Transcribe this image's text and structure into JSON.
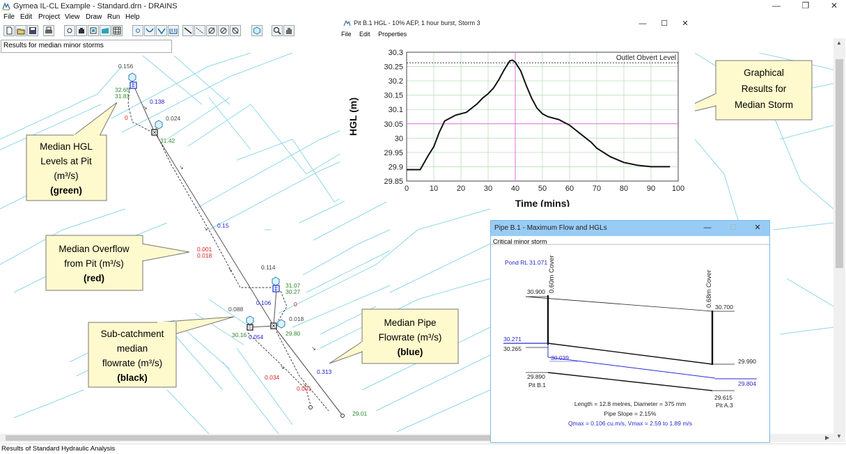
{
  "app": {
    "title": "Gymea IL-CL Example - Standard.drn - DRAINS",
    "icon": "drains-app-icon"
  },
  "window_controls": {
    "minimize": "—",
    "restore": "❐",
    "close": "✕"
  },
  "menu": [
    "File",
    "Edit",
    "Project",
    "View",
    "Draw",
    "Run",
    "Help"
  ],
  "toolbar": {
    "icons": [
      "new-file-icon",
      "open-file-icon",
      "save-icon",
      "print-icon",
      "node-icon",
      "pit-icon",
      "detention-icon",
      "storage-icon",
      "grid-icon",
      "node-circle-icon",
      "channel-icon",
      "overflow-route-icon",
      "weir-icon",
      "pipe-icon",
      "link-icon",
      "sub-catchment-icon",
      "detention-basin-icon",
      "hexagon-icon",
      "zoom-icon",
      "pan-hand-icon"
    ]
  },
  "results_label": "Results for median minor storms",
  "status_bar": "Results of Standard Hydraulic Analysis",
  "drawing": {
    "labels": {
      "pit1_flow": "0.156",
      "pit1_hgl_top": "32.65",
      "pit1_hgl_bottom": "31.81",
      "pit1_overflow": "0",
      "pipe1_flow": "0.138",
      "node2_flow": "0.024",
      "node2_hgl": "31.42",
      "pipe2_flow": "0.15",
      "overflow_a": "0.001",
      "overflow_b": "0.018",
      "pit3_flow": "0.114",
      "pit3_hgl_top": "31.07",
      "pit3_hgl_bottom": "30.27",
      "pit3_overflow": "0",
      "pipe3_flow": "0.106",
      "node4_flow": "0.018",
      "sub_flow": "0.088",
      "sub_hgl": "30.16",
      "sub_pipe_flow": "0.054",
      "node5_hgl": "29.80",
      "overflow_c": "0.034",
      "overflow_d": "0.001",
      "pipe5_flow": "0.313",
      "outlet_hgl": "29.01"
    },
    "colors": {
      "hgl": "#2e8b2e",
      "overflow": "#dd2222",
      "pipe_flow": "#2020d0",
      "catchment_flow": "#333333"
    }
  },
  "callouts": {
    "hgl": {
      "lines": [
        "Median HGL",
        "Levels at Pit",
        "(m³/s)"
      ],
      "emphasis": "(green)",
      "emphasis_color": "#2e9c2e"
    },
    "overflow": {
      "lines": [
        "Median Overflow",
        "from Pit (m³/s)"
      ],
      "emphasis": "(red)",
      "emphasis_color": "#e02020"
    },
    "subcatchment": {
      "lines": [
        "Sub-catchment",
        "median",
        "flowrate (m³/s)"
      ],
      "emphasis": "(black)",
      "emphasis_color": "#000000"
    },
    "pipe": {
      "lines": [
        "Median Pipe",
        "Flowrate (m³/s)"
      ],
      "emphasis": "(blue)",
      "emphasis_color": "#2222cc"
    },
    "graph": {
      "lines": [
        "Graphical",
        "Results for",
        "Median Storm"
      ]
    }
  },
  "hgl_window": {
    "title": "Pit B.1 HGL  -  10% AEP, 1 hour burst, Storm 3",
    "menu": [
      "File",
      "Edit",
      "Properties"
    ],
    "controls": {
      "minimize": "—",
      "maximize": "☐",
      "close": "✕"
    },
    "icon": "graph-window-icon"
  },
  "chart_data": {
    "type": "line",
    "title": "",
    "xlabel": "Time (mins)",
    "ylabel": "HGL (m)",
    "xlim": [
      0,
      100
    ],
    "ylim": [
      29.85,
      30.3
    ],
    "x_ticks": [
      "0",
      "10",
      "20",
      "30",
      "40",
      "50",
      "60",
      "70",
      "80",
      "90",
      "100"
    ],
    "y_ticks": [
      "29.85",
      "29.9",
      "29.95",
      "30",
      "30.05",
      "30.1",
      "30.15",
      "30.2",
      "30.25",
      "30.3"
    ],
    "grid": true,
    "reference_line": {
      "label": "Outlet Obvert Level",
      "value": 30.263
    },
    "highlight_x": 40,
    "highlight_y": 30.05,
    "series": [
      {
        "x": [
          0,
          3,
          5,
          8,
          10,
          12,
          14,
          18,
          22,
          24,
          26,
          28,
          30,
          32,
          34,
          36,
          38,
          39,
          40,
          42,
          44,
          46,
          48,
          50,
          52,
          54,
          56,
          58,
          60,
          62,
          64,
          66,
          68,
          70,
          75,
          80,
          85,
          90,
          95,
          97
        ],
        "y": [
          29.89,
          29.89,
          29.89,
          29.94,
          29.97,
          30.02,
          30.06,
          30.08,
          30.09,
          30.105,
          30.12,
          30.14,
          30.155,
          30.175,
          30.205,
          30.24,
          30.27,
          30.272,
          30.265,
          30.235,
          30.185,
          30.14,
          30.105,
          30.085,
          30.075,
          30.07,
          30.065,
          30.055,
          30.045,
          30.03,
          30.015,
          30.0,
          29.985,
          29.965,
          29.935,
          29.915,
          29.905,
          29.9,
          29.9,
          29.9
        ]
      }
    ]
  },
  "pipe_window": {
    "title": "Pipe B.1 - Maximum Flow and HGLs",
    "subtitle": "Critical minor storm",
    "controls": {
      "minimize": "—",
      "maximize": "☐",
      "close": "✕"
    },
    "pond_rl": "Pond RL 31.071",
    "cover_left": "0.60m Cover",
    "cover_right": "0.68m Cover",
    "surface_left": "30.900",
    "surface_right": "30.700",
    "hgl_left_a": "30.271",
    "hgl_left_b": "30.265",
    "hgl_mid": "30.039",
    "obvert_right": "29.990",
    "invert_left": "29.890",
    "invert_right_hgl": "29.804",
    "invert_right": "29.615",
    "pit_left": "Pit B.1",
    "pit_right": "Pit A.3",
    "length_line": "Length = 12.8 metres,  Diameter = 375 mm",
    "slope_line": "Pipe Slope = 2.15%",
    "q_line": "Qmax = 0.106 cu.m/s,  Vmax = 2.59 to 1.89 m/s"
  }
}
